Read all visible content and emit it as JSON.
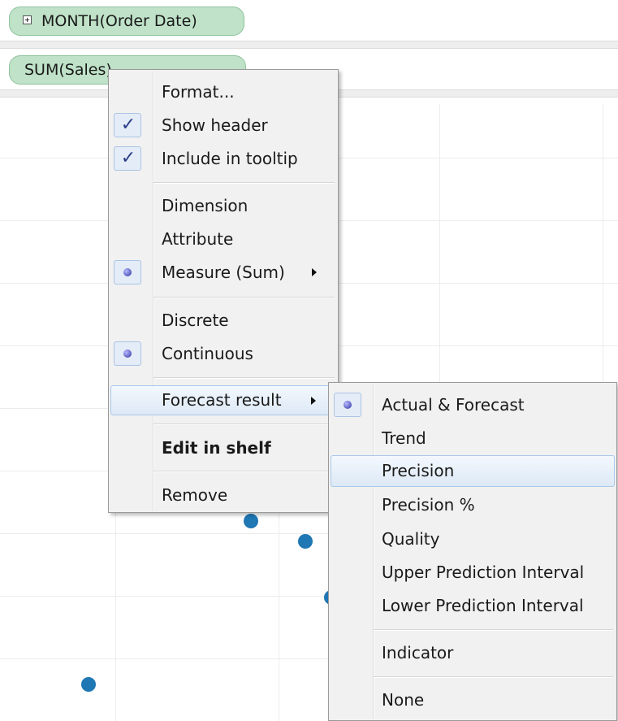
{
  "shelves": {
    "columns_pill": "MONTH(Order Date)",
    "rows_pill": "SUM(Sales)"
  },
  "context_menu": {
    "items": [
      {
        "label": "Format...",
        "state": "none"
      },
      {
        "label": "Show header",
        "state": "checked"
      },
      {
        "label": "Include in tooltip",
        "state": "checked"
      },
      {
        "label": "Dimension",
        "state": "none"
      },
      {
        "label": "Attribute",
        "state": "none"
      },
      {
        "label": "Measure (Sum)",
        "state": "selected",
        "submenu": true
      },
      {
        "label": "Discrete",
        "state": "none"
      },
      {
        "label": "Continuous",
        "state": "selected"
      },
      {
        "label": "Forecast result",
        "state": "none",
        "submenu": true,
        "highlighted": true
      },
      {
        "label": "Edit in shelf",
        "state": "none",
        "bold": true
      },
      {
        "label": "Remove",
        "state": "none"
      }
    ]
  },
  "forecast_submenu": {
    "items": [
      {
        "label": "Actual & Forecast",
        "state": "selected"
      },
      {
        "label": "Trend",
        "state": "none"
      },
      {
        "label": "Precision",
        "state": "none",
        "highlighted": true
      },
      {
        "label": "Precision %",
        "state": "none"
      },
      {
        "label": "Quality",
        "state": "none"
      },
      {
        "label": "Upper Prediction Interval",
        "state": "none"
      },
      {
        "label": "Lower Prediction Interval",
        "state": "none"
      },
      {
        "label": "Indicator",
        "state": "none"
      },
      {
        "label": "None",
        "state": "none"
      }
    ]
  },
  "colors": {
    "pill_fill": "#bfe2c8",
    "mark_color": "#1f77b4",
    "highlight_border": "#a9c8ea"
  },
  "icons": {
    "check": "check-icon",
    "radio": "radio-dot-icon",
    "submenu": "submenu-arrow-icon",
    "expand": "expand-plus-icon"
  }
}
